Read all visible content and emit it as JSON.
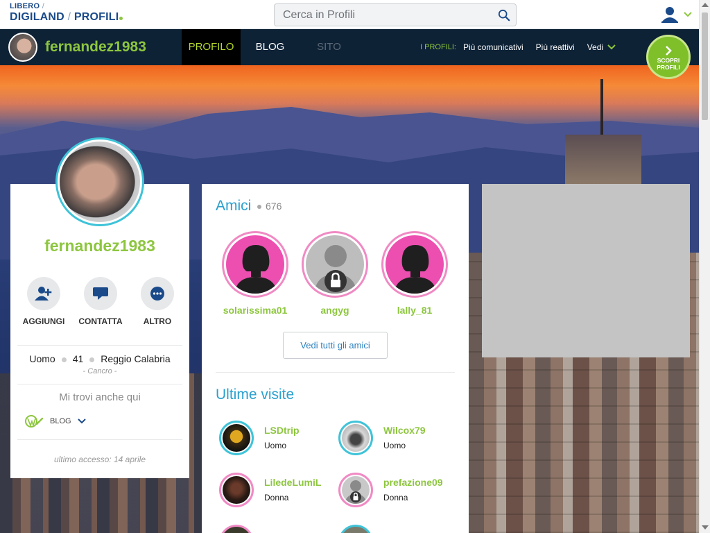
{
  "header": {
    "logo_line1": "LIBERO",
    "logo_line2a": "DIGILAND",
    "logo_line2b": "PROFILI",
    "search_placeholder": "Cerca in Profili"
  },
  "nav": {
    "username": "fernandez1983",
    "tabs": [
      {
        "label": "PROFILO",
        "state": "active"
      },
      {
        "label": "BLOG",
        "state": "normal"
      },
      {
        "label": "SITO",
        "state": "disabled"
      }
    ],
    "links_label": "I PROFILI:",
    "links": [
      "Più comunicativi",
      "Più reattivi",
      "Vedi"
    ],
    "scopri_line1": "SCOPRI",
    "scopri_line2": "PROFILI"
  },
  "profile": {
    "name": "fernandez1983",
    "actions": [
      {
        "label": "AGGIUNGI",
        "icon": "add-user-icon"
      },
      {
        "label": "CONTATTA",
        "icon": "chat-bubble-icon"
      },
      {
        "label": "ALTRO",
        "icon": "more-dots-icon"
      }
    ],
    "gender": "Uomo",
    "age": "41",
    "city": "Reggio Calabria",
    "zodiac": "- Cancro -",
    "find_me": "Mi trovi anche qui",
    "blog_label": "BLOG",
    "last_access": "ultimo accesso: 14 aprile"
  },
  "friends": {
    "title": "Amici",
    "count": "676",
    "items": [
      {
        "name": "solarissima01",
        "locked": false
      },
      {
        "name": "angyg",
        "locked": true
      },
      {
        "name": "lally_81",
        "locked": false
      }
    ],
    "see_all": "Vedi tutti gli amici"
  },
  "visits": {
    "title": "Ultime visite",
    "items": [
      {
        "name": "LSDtrip",
        "gender": "Uomo"
      },
      {
        "name": "Wilcox79",
        "gender": "Uomo"
      },
      {
        "name": "LiledeLumiL",
        "gender": "Donna"
      },
      {
        "name": "prefazione09",
        "gender": "Donna"
      }
    ]
  },
  "colors": {
    "brand_green": "#8dc63f",
    "link_blue": "#2aa0cf",
    "nav_bg": "#0e2236",
    "female_ring": "#f08ac4",
    "male_ring": "#3fc3d8"
  }
}
